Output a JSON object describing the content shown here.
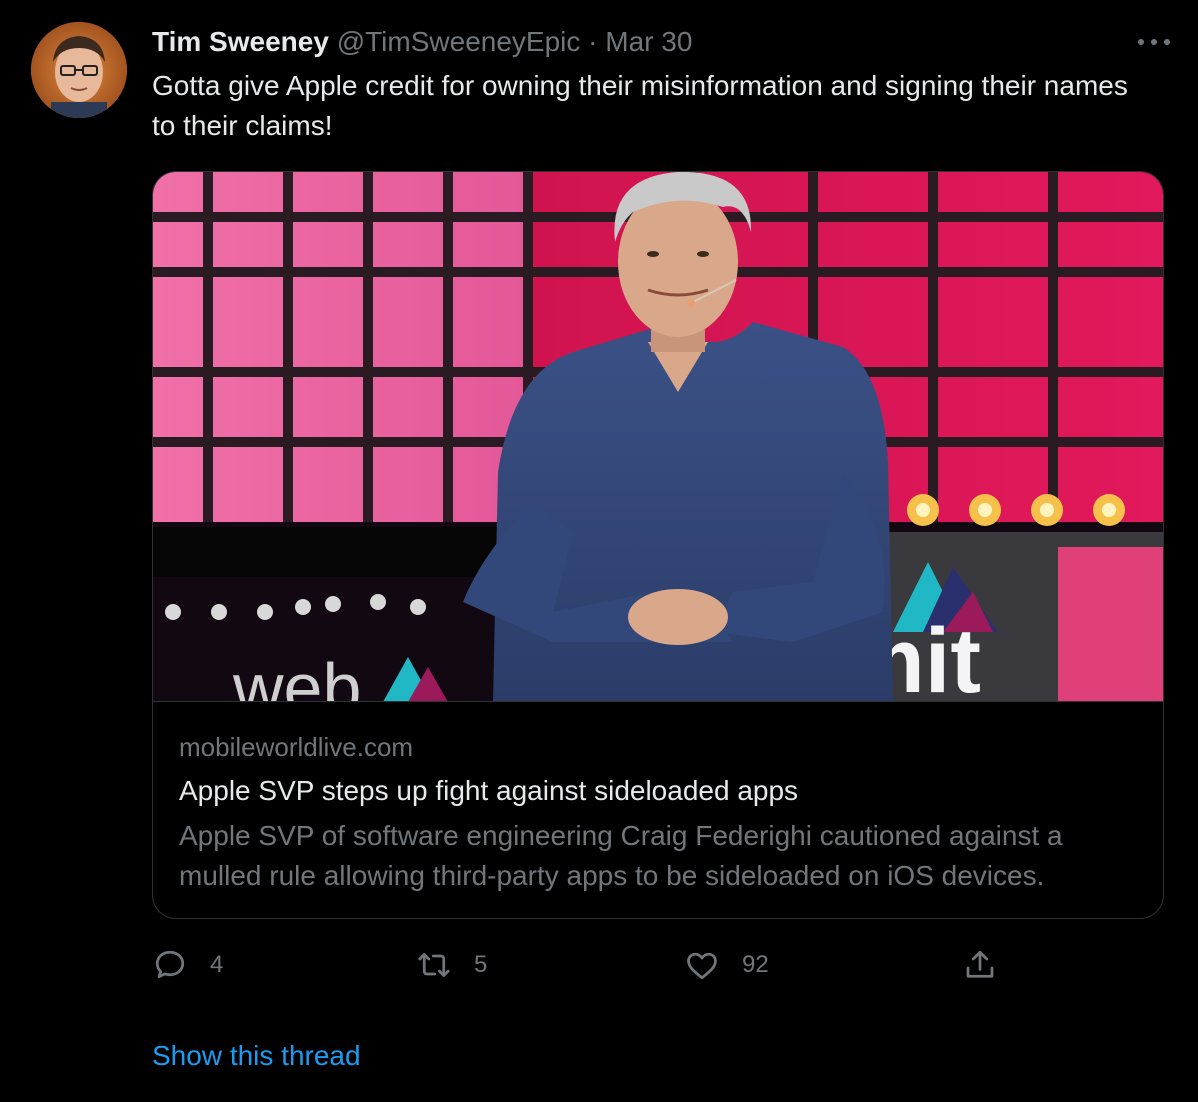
{
  "tweet": {
    "author_name": "Tim Sweeney",
    "handle": "@TimSweeneyEpic",
    "separator": "·",
    "date": "Mar 30",
    "text": "Gotta give Apple credit for owning their misinformation and signing their names to their claims!"
  },
  "card": {
    "domain": "mobileworldlive.com",
    "title": "Apple SVP steps up fight against sideloaded apps",
    "description": "Apple SVP of software engineering Craig Federighi cautioned against a mulled rule allowing third-party apps to be sideloaded on iOS devices.",
    "image_logo_text": "web summit"
  },
  "actions": {
    "reply": {
      "icon": "reply-icon",
      "count": "4"
    },
    "retweet": {
      "icon": "retweet-icon",
      "count": "5"
    },
    "like": {
      "icon": "heart-icon",
      "count": "92"
    },
    "share": {
      "icon": "share-icon"
    }
  },
  "footer": {
    "show_thread": "Show this thread"
  },
  "colors": {
    "background": "#000000",
    "text_primary": "#e7e9ea",
    "text_secondary": "#71767b",
    "link": "#1d9bf0",
    "border": "#2f3336"
  }
}
